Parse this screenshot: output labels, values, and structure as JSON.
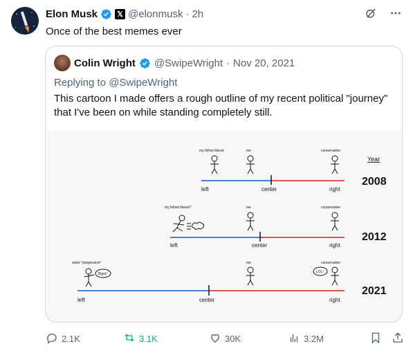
{
  "author": {
    "name": "Elon Musk",
    "handle": "@elonmusk",
    "separator": "·",
    "time": "2h",
    "affiliate_badge": "𝕏"
  },
  "tweet": {
    "text": "Once of the best memes ever"
  },
  "quoted": {
    "name": "Colin Wright",
    "handle": "@SwipeWright",
    "separator": "·",
    "date": "Nov 20, 2021",
    "reply_to": "Replying to @SwipeWright",
    "text": "This cartoon I made offers a rough outline of my recent political \"journey\" that I've been on while standing completely still.",
    "image": {
      "year_header": "Year",
      "rows": [
        {
          "year": "2008",
          "left_label": "left",
          "center_label": "center",
          "right_label": "right",
          "left_figure_caption": "my fellow liberal",
          "me_caption": "me",
          "right_figure_caption": "conservative"
        },
        {
          "year": "2012",
          "left_label": "left",
          "center_label": "center",
          "right_label": "right",
          "left_figure_caption": "my fellow liberal?",
          "me_caption": "me",
          "right_figure_caption": "conservative"
        },
        {
          "year": "2021",
          "left_label": "left",
          "center_label": "center",
          "right_label": "right",
          "left_figure_caption": "woke \"progressive\"",
          "left_speech": "Bigot!",
          "me_caption": "me",
          "right_figure_caption": "conservative",
          "right_speech": "LOL!"
        }
      ],
      "colors": {
        "left_line": "#4a7fd6",
        "right_line": "#e0524a"
      }
    }
  },
  "actions": {
    "replies": "2.1K",
    "retweets": "3.1K",
    "likes": "30K",
    "views": "3.2M"
  },
  "icons": [
    "grok-icon",
    "more-icon",
    "reply-icon",
    "retweet-icon",
    "like-icon",
    "views-icon",
    "bookmark-icon",
    "share-icon"
  ],
  "colors": {
    "verified": "#1d9bf0",
    "retweet_active": "#00ba7c",
    "secondary_text": "#536471"
  }
}
